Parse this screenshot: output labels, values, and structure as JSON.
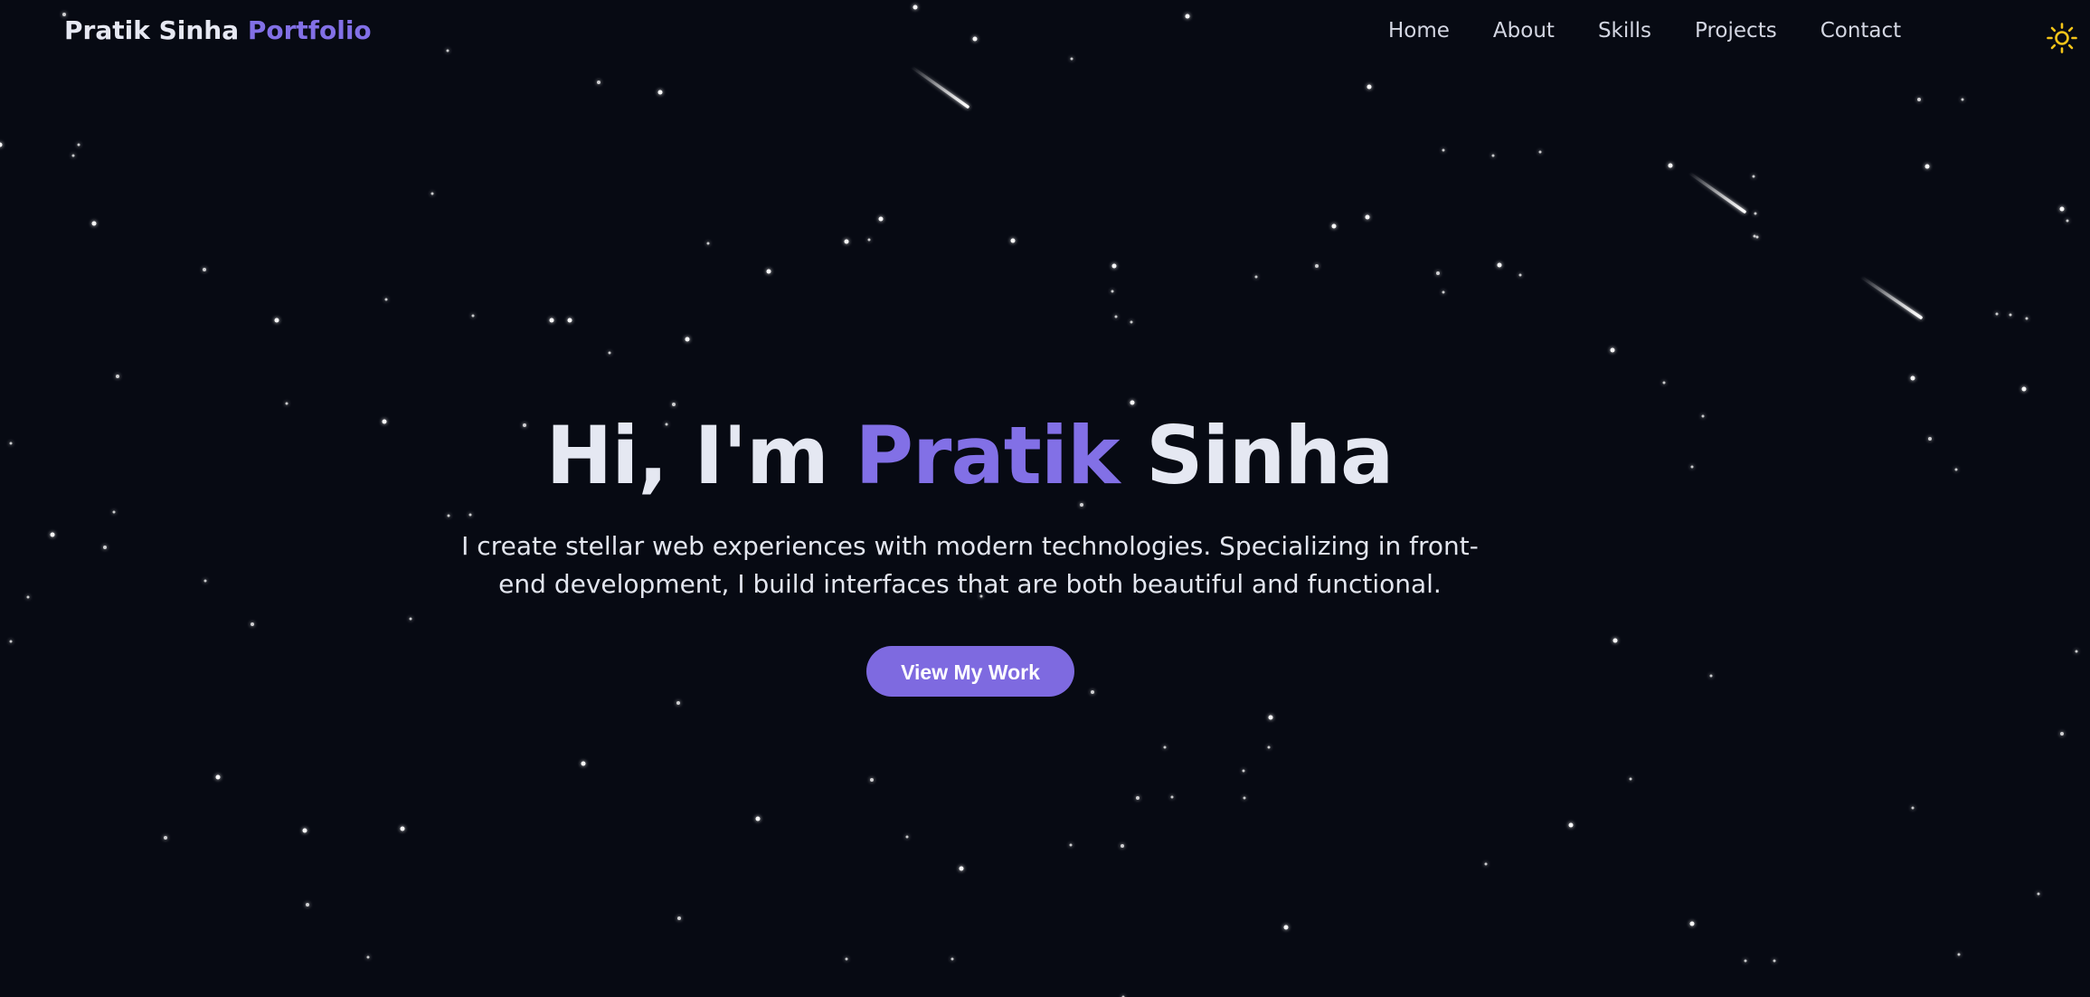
{
  "brand": {
    "name": "Pratik Sinha",
    "suffix": "Portfolio"
  },
  "nav": {
    "items": [
      "Home",
      "About",
      "Skills",
      "Projects",
      "Contact"
    ]
  },
  "theme_toggle": {
    "icon": "sun-icon",
    "color": "#f5c518"
  },
  "hero": {
    "greeting": "Hi, I'm",
    "first_name": "Pratik",
    "last_name": "Sinha",
    "subtitle": "I create stellar web experiences with modern technologies. Specializing in front-end development, I build interfaces that are both beautiful and functional.",
    "cta_label": "View My Work"
  },
  "colors": {
    "background": "#070a13",
    "accent": "#8270e6",
    "button": "#7e6ae0",
    "text": "#e5e8f2"
  }
}
